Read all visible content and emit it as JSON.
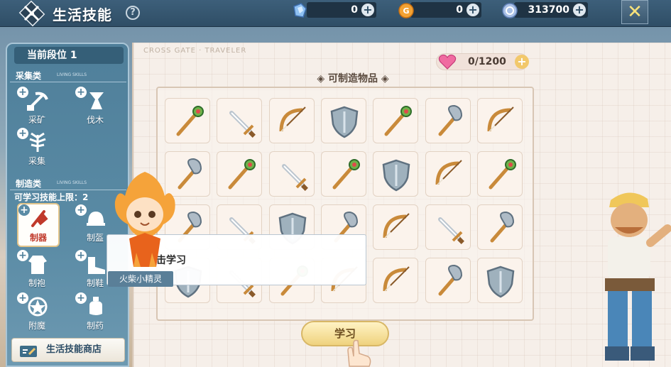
{
  "header": {
    "title": "生活技能",
    "help_label": "?",
    "currencies": [
      {
        "name": "crystal",
        "icon": "crystal-icon",
        "value": "0",
        "color": "#7fb0e8"
      },
      {
        "name": "gold",
        "icon": "gold-coin-icon",
        "value": "0",
        "color": "#f0a23a"
      },
      {
        "name": "silver",
        "icon": "silver-coin-icon",
        "value": "313700",
        "color": "#8eaad6"
      }
    ],
    "close_label": "✕"
  },
  "left": {
    "rank_label": "当前段位  1",
    "gather_section": {
      "title": "采集类",
      "subtitle": "LIVING SKILLS"
    },
    "gather_skills": [
      {
        "label": "采矿",
        "icon": "mining-icon"
      },
      {
        "label": "伐木",
        "icon": "logging-icon"
      },
      {
        "label": "采集",
        "icon": "herb-gathering-icon"
      }
    ],
    "craft_section": {
      "title": "制造类",
      "subtitle": "LIVING SKILLS"
    },
    "limit_text": "可学习技能上限：2",
    "craft_skills": [
      {
        "label": "制器",
        "icon": "weapon-craft-icon",
        "active": true
      },
      {
        "label": "制盔",
        "icon": "helmet-craft-icon"
      },
      {
        "label": "制袍",
        "icon": "robe-craft-icon"
      },
      {
        "label": "制鞋",
        "icon": "shoe-craft-icon"
      },
      {
        "label": "附魔",
        "icon": "enchant-icon"
      },
      {
        "label": "制药",
        "icon": "potion-icon"
      }
    ],
    "shop_label": "生活技能商店"
  },
  "main": {
    "brand_text": "CROSS GATE · TRAVELER",
    "stamina": "0/1200",
    "craftable_title": "可制造物品",
    "items": [
      "staff-icon",
      "sword-icon",
      "bow-icon",
      "shield-icon",
      "staff-icon",
      "axe-icon",
      "bow-icon",
      "axe-icon",
      "staff-icon",
      "sword-icon",
      "staff-icon",
      "shield-icon",
      "bow-icon",
      "staff-icon",
      "axe-icon",
      "sword-icon",
      "shield-icon",
      "axe-icon",
      "bow-icon",
      "sword-icon",
      "axe-icon",
      "shield-icon",
      "sword-icon",
      "staff-icon",
      "bow-icon",
      "bow-icon",
      "axe-icon",
      "shield-icon"
    ],
    "learn_button": "学习",
    "tooltip_text": "点击学习",
    "sprite_name": "火柴小精灵"
  },
  "colors": {
    "accent": "#4f7f9a",
    "panel_bg": "#f6efe9",
    "active_label": "#c0392b"
  }
}
